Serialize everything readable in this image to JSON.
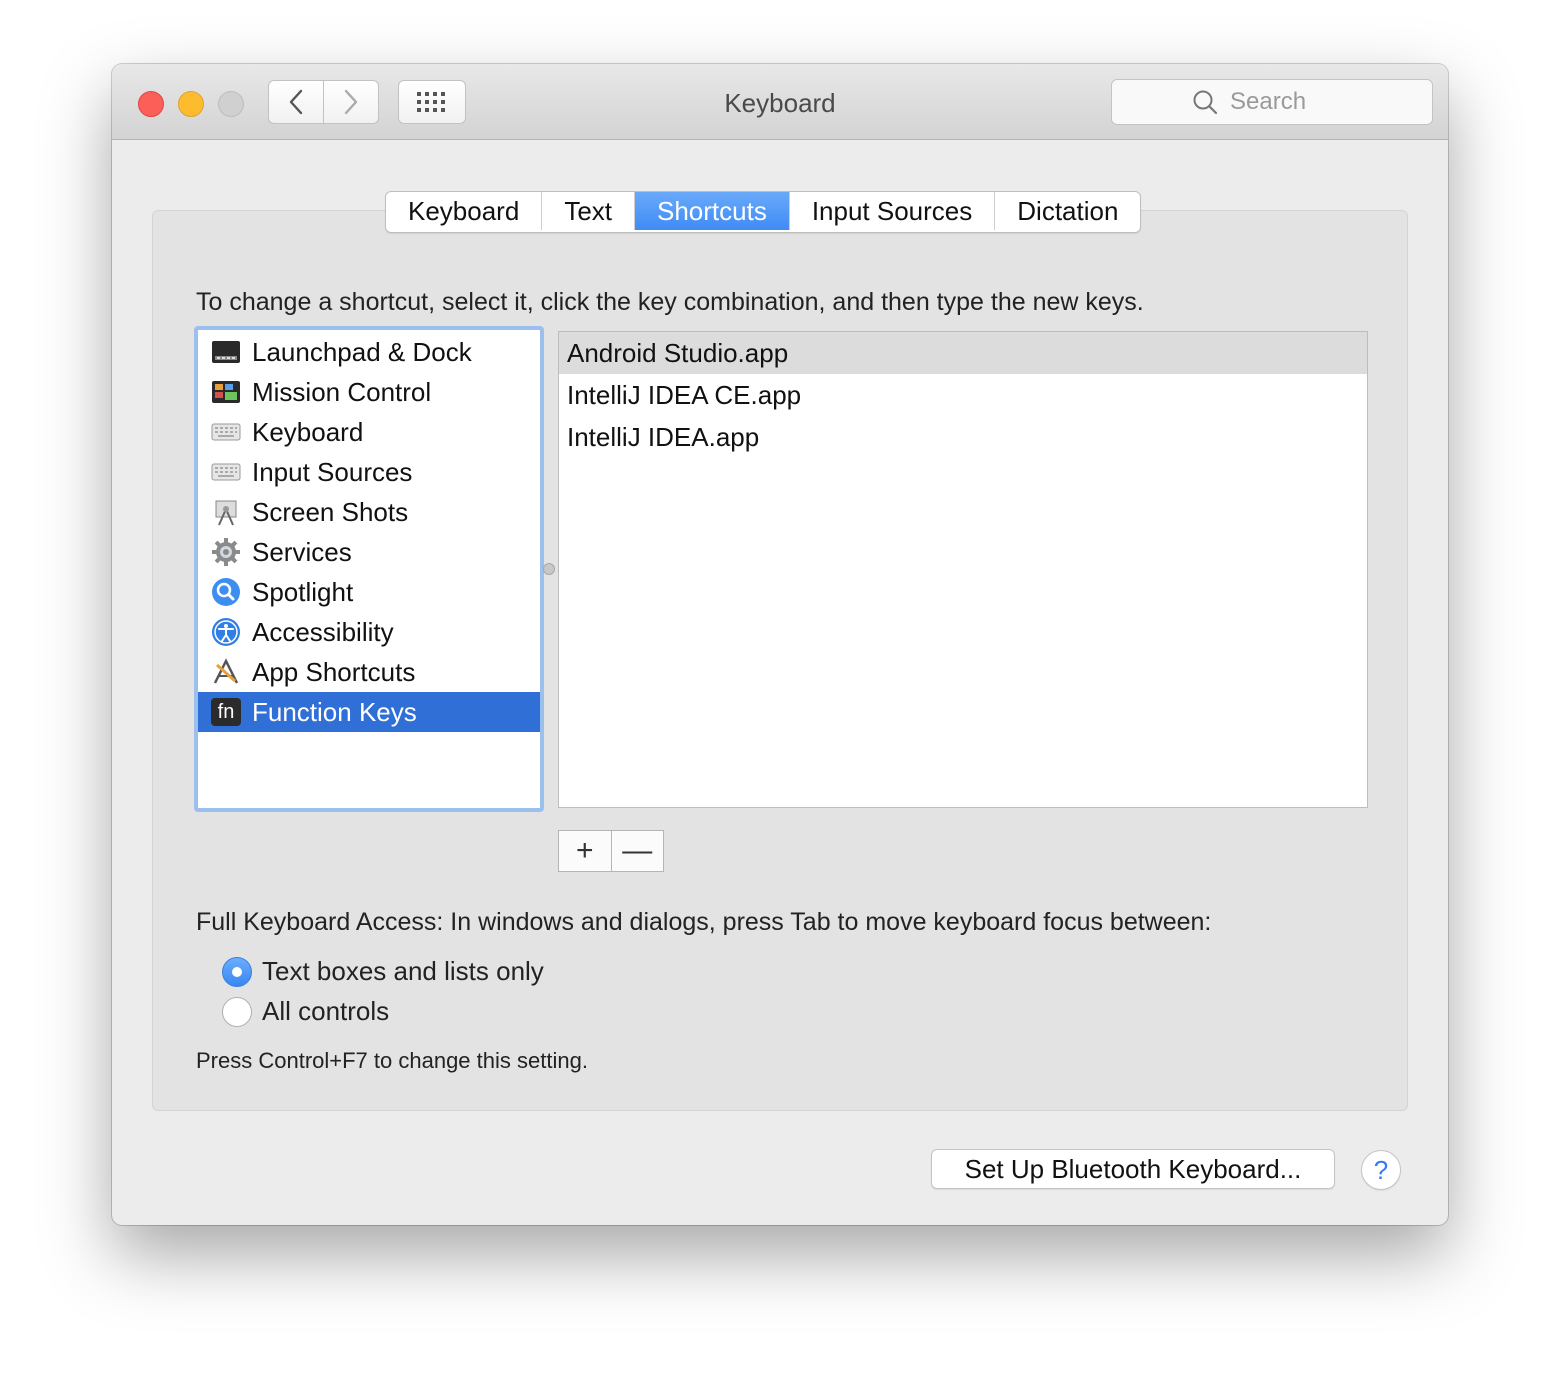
{
  "window": {
    "title": "Keyboard"
  },
  "search": {
    "placeholder": "Search"
  },
  "tabs": [
    {
      "label": "Keyboard",
      "active": false
    },
    {
      "label": "Text",
      "active": false
    },
    {
      "label": "Shortcuts",
      "active": true
    },
    {
      "label": "Input Sources",
      "active": false
    },
    {
      "label": "Dictation",
      "active": false
    }
  ],
  "instructions": "To change a shortcut, select it, click the key combination, and then type the new keys.",
  "categories": [
    {
      "label": "Launchpad & Dock",
      "icon": "launchpad-dock-icon",
      "selected": false
    },
    {
      "label": "Mission Control",
      "icon": "mission-control-icon",
      "selected": false
    },
    {
      "label": "Keyboard",
      "icon": "keyboard-icon",
      "selected": false
    },
    {
      "label": "Input Sources",
      "icon": "input-sources-icon",
      "selected": false
    },
    {
      "label": "Screen Shots",
      "icon": "screenshot-icon",
      "selected": false
    },
    {
      "label": "Services",
      "icon": "gear-icon",
      "selected": false
    },
    {
      "label": "Spotlight",
      "icon": "spotlight-icon",
      "selected": false
    },
    {
      "label": "Accessibility",
      "icon": "accessibility-icon",
      "selected": false
    },
    {
      "label": "App Shortcuts",
      "icon": "app-shortcuts-icon",
      "selected": false
    },
    {
      "label": "Function Keys",
      "icon": "fn-key-icon",
      "selected": true
    }
  ],
  "fn_icon_text": "fn",
  "apps": [
    {
      "label": "Android Studio.app",
      "selected": true
    },
    {
      "label": "IntelliJ IDEA CE.app",
      "selected": false
    },
    {
      "label": "IntelliJ IDEA.app",
      "selected": false
    }
  ],
  "add_remove": {
    "add_label": "+",
    "remove_label": "—"
  },
  "full_keyboard_access": {
    "label": "Full Keyboard Access: In windows and dialogs, press Tab to move keyboard focus between:",
    "options": [
      {
        "label": "Text boxes and lists only",
        "selected": true
      },
      {
        "label": "All controls",
        "selected": false
      }
    ],
    "hint": "Press Control+F7 to change this setting."
  },
  "footer": {
    "bluetooth_button": "Set Up Bluetooth Keyboard...",
    "help_label": "?"
  },
  "colors": {
    "accent": "#3f8cf5",
    "selection": "#2f6fd6",
    "close": "#fc5f57",
    "minimize": "#fdbc2e"
  }
}
